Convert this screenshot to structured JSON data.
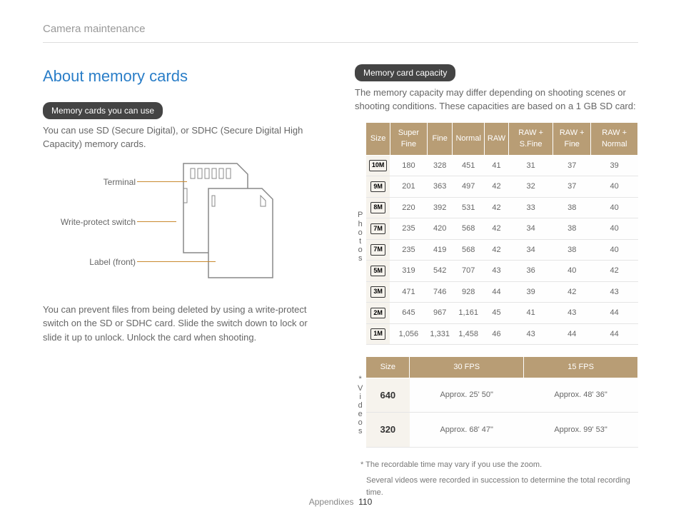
{
  "breadcrumb": "Camera maintenance",
  "title": "About memory cards",
  "left": {
    "pill1": "Memory cards you can use",
    "p1": "You can use SD (Secure Digital), or SDHC (Secure Digital High Capacity) memory cards.",
    "diagram": {
      "terminal": "Terminal",
      "write": "Write-protect switch",
      "label": "Label (front)"
    },
    "p2": "You can prevent files from being deleted by using a write-protect switch on the SD or SDHC card. Slide the switch down to lock or slide it up to unlock. Unlock the card when shooting."
  },
  "right": {
    "pill2": "Memory card capacity",
    "p3": "The memory capacity may differ depending on shooting scenes or shooting conditions. These capacities are based on a 1 GB SD card:",
    "photos_label": "Photos",
    "videos_label": "*Videos",
    "headers": [
      "Size",
      "Super Fine",
      "Fine",
      "Normal",
      "RAW",
      "RAW + S.Fine",
      "RAW + Fine",
      "RAW + Normal"
    ],
    "rows": [
      {
        "size": "10M",
        "v": [
          "180",
          "328",
          "451",
          "41",
          "31",
          "37",
          "39"
        ]
      },
      {
        "size": "9M",
        "v": [
          "201",
          "363",
          "497",
          "42",
          "32",
          "37",
          "40"
        ]
      },
      {
        "size": "8M",
        "v": [
          "220",
          "392",
          "531",
          "42",
          "33",
          "38",
          "40"
        ]
      },
      {
        "size": "7M",
        "v": [
          "235",
          "420",
          "568",
          "42",
          "34",
          "38",
          "40"
        ]
      },
      {
        "size": "7M",
        "v": [
          "235",
          "419",
          "568",
          "42",
          "34",
          "38",
          "40"
        ]
      },
      {
        "size": "5M",
        "v": [
          "319",
          "542",
          "707",
          "43",
          "36",
          "40",
          "42"
        ]
      },
      {
        "size": "3M",
        "v": [
          "471",
          "746",
          "928",
          "44",
          "39",
          "42",
          "43"
        ]
      },
      {
        "size": "2M",
        "v": [
          "645",
          "967",
          "1,161",
          "45",
          "41",
          "43",
          "44"
        ]
      },
      {
        "size": "1M",
        "v": [
          "1,056",
          "1,331",
          "1,458",
          "46",
          "43",
          "44",
          "44"
        ]
      }
    ],
    "video_headers": [
      "Size",
      "30 FPS",
      "15 FPS"
    ],
    "video_rows": [
      {
        "size": "640",
        "v": [
          "Approx. 25' 50\"",
          "Approx. 48' 36\""
        ]
      },
      {
        "size": "320",
        "v": [
          "Approx. 68' 47\"",
          "Approx. 99' 53\""
        ]
      }
    ],
    "footnote1": "* The recordable time may vary if you use the zoom.",
    "footnote2": "Several videos were recorded in succession to determine the total recording time."
  },
  "footer": {
    "section": "Appendixes",
    "page": "110"
  }
}
